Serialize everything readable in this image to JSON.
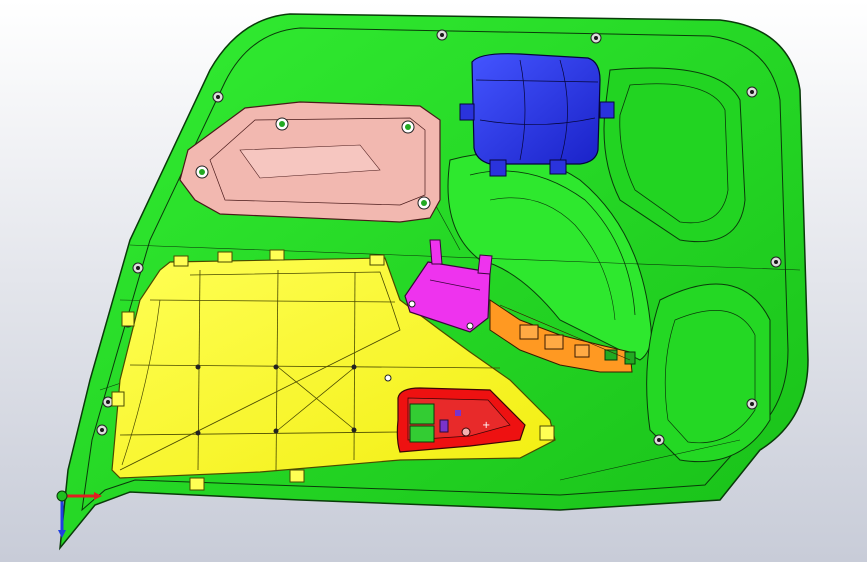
{
  "viewport": {
    "background_top": "#ffffff",
    "background_bottom": "#c8ccd8"
  },
  "model": {
    "parts": [
      {
        "name": "door-trim-panel",
        "color": "#22dd22"
      },
      {
        "name": "map-pocket",
        "color": "#ffff33"
      },
      {
        "name": "armrest-bracket",
        "color": "#f2b8b0"
      },
      {
        "name": "speaker-housing",
        "color": "#2233ee"
      },
      {
        "name": "clip-bracket",
        "color": "#ee33ee"
      },
      {
        "name": "switch-panel",
        "color": "#ee1111"
      },
      {
        "name": "wire-harness",
        "color": "#ff9922"
      }
    ]
  },
  "triad": {
    "x_color": "#e02020",
    "y_color": "#20c020",
    "z_color": "#2040e0"
  }
}
